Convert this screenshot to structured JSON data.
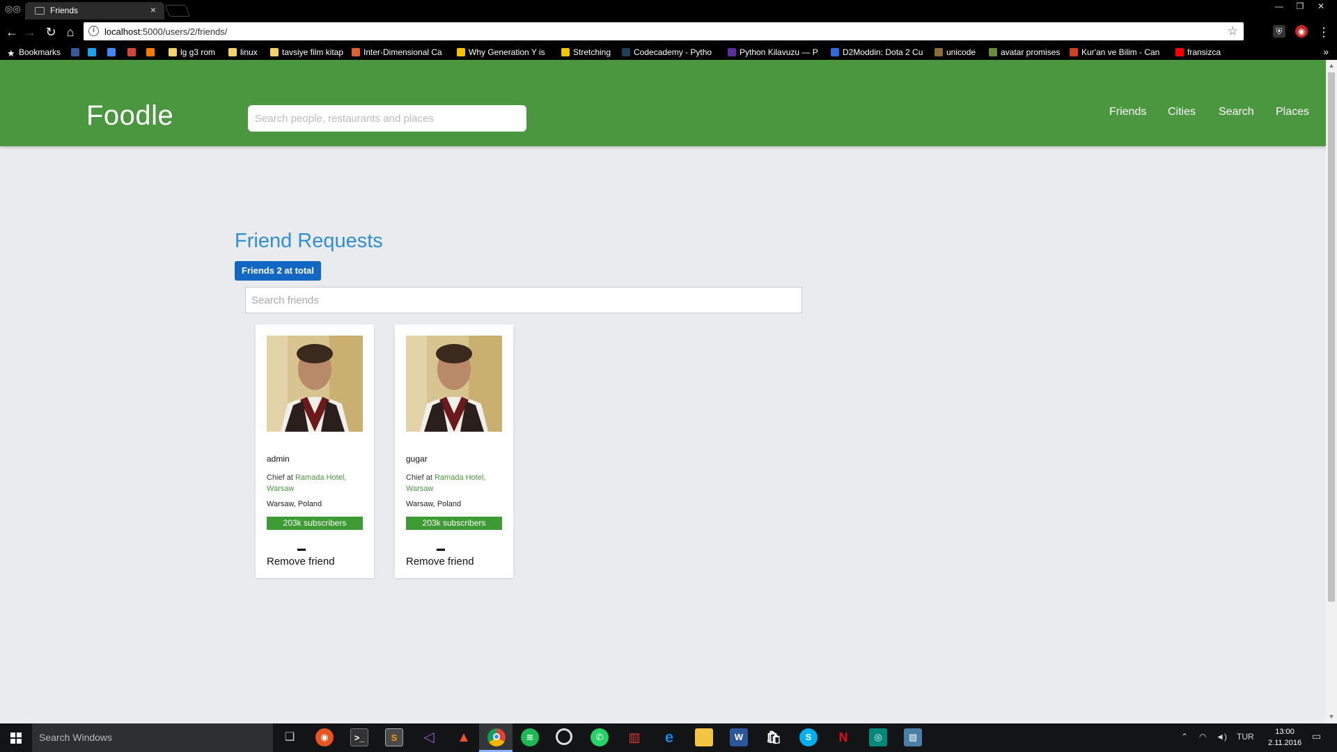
{
  "browser": {
    "tab_title": "Friends",
    "tab_close": "×",
    "url_host": "localhost",
    "url_rest": ":5000/users/2/friends/",
    "bookmarks_bar": [
      {
        "label": "Bookmarks",
        "color": "#ffffff"
      },
      {
        "label": "",
        "color": "#3b5998"
      },
      {
        "label": "",
        "color": "#1da1f2"
      },
      {
        "label": "",
        "color": "#4285f4"
      },
      {
        "label": "",
        "color": "#d44638"
      },
      {
        "label": "",
        "color": "#f57c00"
      },
      {
        "label": "lg g3 rom",
        "color": "#f5d36a"
      },
      {
        "label": "linux",
        "color": "#f5d36a"
      },
      {
        "label": "tavsiye film kitap",
        "color": "#f5d36a"
      },
      {
        "label": "Inter-Dimensional Ca",
        "color": "#e06030"
      },
      {
        "label": "Why Generation Y is",
        "color": "#f2c500"
      },
      {
        "label": "Stretching",
        "color": "#f2c500"
      },
      {
        "label": "Codecademy - Pytho",
        "color": "#1f4056"
      },
      {
        "label": "Python Kilavuzu — P",
        "color": "#5a2ea0"
      },
      {
        "label": "D2Moddin: Dota 2 Cu",
        "color": "#2d6bd6"
      },
      {
        "label": "unicode",
        "color": "#8a6d3b"
      },
      {
        "label": "avatar promises",
        "color": "#6a8a3b"
      },
      {
        "label": "Kur'an ve Bilim - Can",
        "color": "#d04020"
      },
      {
        "label": "fransizca",
        "color": "#ff0000"
      }
    ]
  },
  "site": {
    "brand": "Foodle",
    "search_placeholder": "Search people, restaurants and places",
    "nav": [
      "Friends",
      "Cities",
      "Search",
      "Places"
    ],
    "accent_color": "#4a973f"
  },
  "main": {
    "title": "Friend Requests",
    "count_badge": "Friends 2 at total",
    "search_placeholder": "Search friends",
    "friends": [
      {
        "name": "admin",
        "job_prefix": "Chief at",
        "job_place": "Ramada Hotel, Warsaw",
        "location": "Warsaw, Poland",
        "subscribers": "203k subscribers",
        "action": "Remove friend"
      },
      {
        "name": "gugar",
        "job_prefix": "Chief at",
        "job_place": "Ramada Hotel, Warsaw",
        "location": "Warsaw, Poland",
        "subscribers": "203k subscribers",
        "action": "Remove friend"
      }
    ]
  },
  "taskbar": {
    "search_placeholder": "Search Windows",
    "language": "TUR",
    "time": "13:00",
    "date": "2.11.2016"
  }
}
